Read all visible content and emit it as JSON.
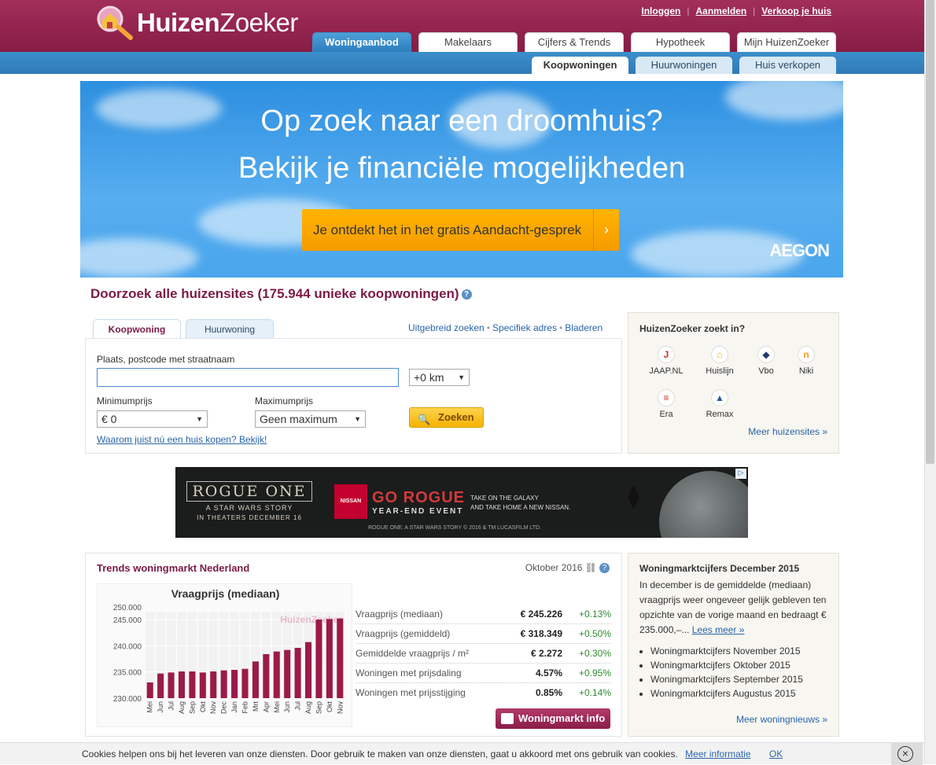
{
  "brand": {
    "name_bold": "Huizen",
    "name_light": "Zoeker"
  },
  "toplinks": [
    "Inloggen",
    "Aanmelden",
    "Verkoop je huis"
  ],
  "maintabs": [
    "Woningaanbod",
    "Makelaars",
    "Cijfers & Trends",
    "Hypotheek",
    "Mijn HuizenZoeker"
  ],
  "subtabs": [
    "Koopwoningen",
    "Huurwoningen",
    "Huis verkopen"
  ],
  "banner": {
    "line1": "Op zoek naar een droomhuis?",
    "line2": "Bekijk je financiële mogelijkheden",
    "button": "Je ontdekt het in het gratis Aandacht-gesprek",
    "sponsor": "AEGON"
  },
  "search": {
    "title": "Doorzoek alle huizensites (175.944 unieke koopwoningen)",
    "tabs": [
      "Koopwoning",
      "Huurwoning"
    ],
    "links": [
      "Uitgebreid zoeken",
      "Specifiek adres",
      "Bladeren"
    ],
    "place_label": "Plaats, postcode met straatnaam",
    "place_value": "",
    "radius": "+0 km",
    "min_label": "Minimumprijs",
    "min_value": "€ 0",
    "max_label": "Maximumprijs",
    "max_value": "Geen maximum",
    "button": "Zoeken",
    "promo_link": "Waarom juist nú een huis kopen? Bekijk!"
  },
  "sites": {
    "title": "HuizenZoeker zoekt in?",
    "items": [
      {
        "name": "JAAP.NL",
        "glyph": "J",
        "color": "#c8332d"
      },
      {
        "name": "Huislijn",
        "glyph": "⌂",
        "color": "#e8b400"
      },
      {
        "name": "Vbo",
        "glyph": "◆",
        "color": "#223a6b"
      },
      {
        "name": "Niki",
        "glyph": "n",
        "color": "#f29b1d"
      },
      {
        "name": "Era",
        "glyph": "≡",
        "color": "#c8332d"
      },
      {
        "name": "Remax",
        "glyph": "▲",
        "color": "#2a5aa8"
      }
    ],
    "more": "Meer huizensites »"
  },
  "ad": {
    "left_title": "ROGUE ONE",
    "left_sub": "A STAR WARS STORY",
    "left_date": "IN THEATERS DECEMBER 16",
    "brand": "NISSAN",
    "headline": "GO ROGUE",
    "headline_sub": "YEAR-END EVENT",
    "tagline1": "TAKE ON THE GALAXY",
    "tagline2": "AND TAKE HOME A NEW NISSAN.",
    "legal": "ROGUE ONE: A STAR WARS STORY © 2016 & TM LUCASFILM LTD."
  },
  "trends": {
    "title": "Trends woningmarkt Nederland",
    "month": "Oktober 2016",
    "stats": [
      {
        "name": "Vraagprijs (mediaan)",
        "value": "€ 245.226",
        "change": "+0.13%"
      },
      {
        "name": "Vraagprijs (gemiddeld)",
        "value": "€ 318.349",
        "change": "+0.50%"
      },
      {
        "name": "Gemiddelde vraagprijs / m²",
        "value": "€ 2.272",
        "change": "+0.30%"
      },
      {
        "name": "Woningen met prijsdaling",
        "value": "4.57%",
        "change": "+0.95%"
      },
      {
        "name": "Woningen met prijsstijging",
        "value": "0.85%",
        "change": "+0.14%"
      }
    ],
    "button": "Woningmarkt info"
  },
  "chart_data": {
    "type": "bar",
    "title": "Vraagprijs (mediaan)",
    "watermark": "HuizenZoeker",
    "categories": [
      "Mei",
      "Jun",
      "Jul",
      "Aug",
      "Sep",
      "Okt",
      "Nov",
      "Dec",
      "Jan",
      "Feb",
      "Mrt",
      "Apr",
      "Mei",
      "Jun",
      "Jul",
      "Aug",
      "Sep",
      "Okt",
      "Nov"
    ],
    "values": [
      233000,
      234700,
      234900,
      235100,
      235100,
      234900,
      235100,
      235300,
      235400,
      235600,
      237000,
      238400,
      238900,
      239200,
      239600,
      240700,
      245000,
      245100,
      245200
    ],
    "ylim": [
      230000,
      246500
    ],
    "yticks": [
      "230.000",
      "235.000",
      "240.000",
      "245.000",
      "250.000"
    ],
    "ytick_values": [
      230000,
      235000,
      240000,
      245000,
      250000
    ],
    "grid": true,
    "bar_color": "#9b1b48"
  },
  "news": {
    "title": "Woningmarktcijfers December 2015",
    "body": "In december is de gemiddelde (mediaan) vraagprijs weer ongeveer gelijk gebleven ten opzichte van de vorige maand en bedraagt € 235.000,–... ",
    "readmore": "Lees meer »",
    "items": [
      "Woningmarktcijfers November 2015",
      "Woningmarktcijfers Oktober 2015",
      "Woningmarktcijfers September 2015",
      "Woningmarktcijfers Augustus 2015"
    ],
    "more": "Meer woningnieuws »"
  },
  "cookie": {
    "text": "Cookies helpen ons bij het leveren van onze diensten. Door gebruik te maken van onze diensten, gaat u akkoord met ons gebruik van cookies.",
    "more": "Meer informatie",
    "ok": "OK"
  }
}
